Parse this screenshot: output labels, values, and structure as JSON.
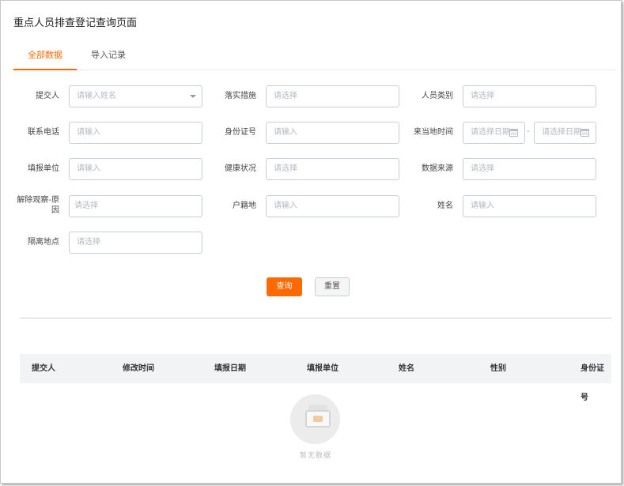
{
  "page": {
    "title": "重点人员排查登记查询页面"
  },
  "tabs": [
    {
      "label": "全部数据",
      "active": true
    },
    {
      "label": "导入记录",
      "active": false
    }
  ],
  "form": {
    "submitter": {
      "label": "提交人",
      "placeholder": "请输入姓名"
    },
    "measures": {
      "label": "落实措施",
      "placeholder": "请选择"
    },
    "category": {
      "label": "人员类别",
      "placeholder": "请选择"
    },
    "phone": {
      "label": "联系电话",
      "placeholder": "请输入"
    },
    "id_number": {
      "label": "身份证号",
      "placeholder": "请输入"
    },
    "arrival_time": {
      "label": "来当地时间",
      "start_placeholder": "请选择日期",
      "end_placeholder": "请选择日期",
      "separator": "-"
    },
    "reporting_unit": {
      "label": "填报单位",
      "placeholder": "请输入"
    },
    "health": {
      "label": "健康状况",
      "placeholder": "请选择"
    },
    "data_source": {
      "label": "数据来源",
      "placeholder": "请选择"
    },
    "release_reason": {
      "label_line1": "解除观察-原",
      "label_line2": "因",
      "placeholder": "请选择"
    },
    "household": {
      "label": "户籍地",
      "placeholder": "请输入"
    },
    "name": {
      "label": "姓名",
      "placeholder": "请输入"
    },
    "isolation_place": {
      "label": "隔离地点",
      "placeholder": "请选择"
    }
  },
  "buttons": {
    "query": "查询",
    "reset": "重置"
  },
  "table": {
    "columns": [
      "提交人",
      "修改时间",
      "填报日期",
      "填报单位",
      "姓名",
      "性别",
      "身份证号"
    ]
  },
  "empty_state": {
    "icon": "empty-box-icon",
    "text": "暂无数据"
  },
  "colors": {
    "accent": "#ff6a00",
    "header_bg": "#f2f3f5",
    "border": "#c9ced6"
  }
}
